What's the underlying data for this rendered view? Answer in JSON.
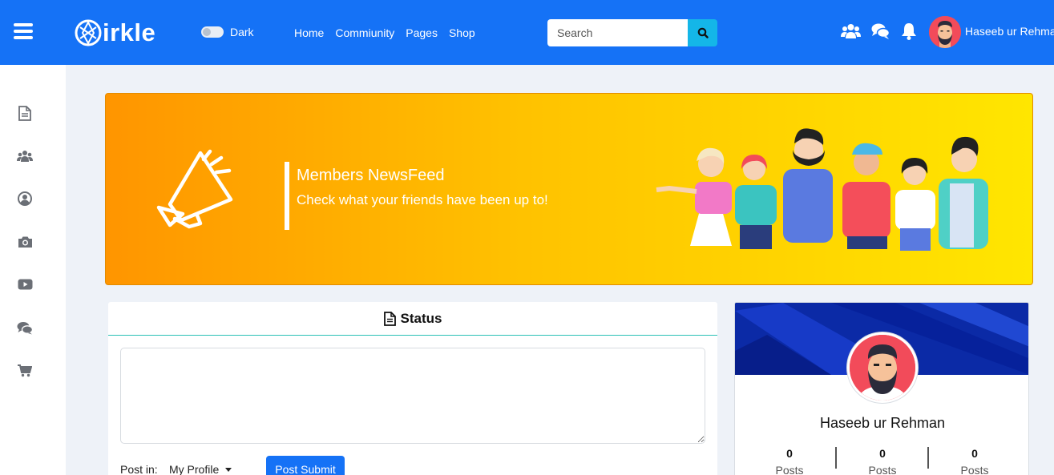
{
  "navbar": {
    "logo_text": "irkle",
    "dark_label": "Dark",
    "links": [
      "Home",
      "Commiunity",
      "Pages",
      "Shop"
    ],
    "search_placeholder": "Search",
    "user_name": "Haseeb ur Rehman",
    "colors": {
      "bar": "#1572f6",
      "search_button": "#14b6e8"
    },
    "icons": [
      "menu-icon",
      "users-icon",
      "chat-icon",
      "bell-icon",
      "search-icon"
    ]
  },
  "sidebar": {
    "icons": [
      "newsfeed-icon",
      "groups-icon",
      "profile-icon",
      "camera-icon",
      "video-icon",
      "messages-icon",
      "cart-icon"
    ]
  },
  "banner": {
    "title": "Members NewsFeed",
    "subtitle": "Check what your friends have been up to!",
    "icon": "megaphone-icon"
  },
  "status": {
    "title": "Status",
    "post_in_label": "Post in:",
    "post_in_value": "My Profile",
    "submit_label": "Post Submit",
    "icon": "document-icon"
  },
  "profile": {
    "name": "Haseeb ur Rehman",
    "stats": [
      {
        "value": "0",
        "label": "Posts"
      },
      {
        "value": "0",
        "label": "Posts"
      },
      {
        "value": "0",
        "label": "Posts"
      }
    ]
  }
}
